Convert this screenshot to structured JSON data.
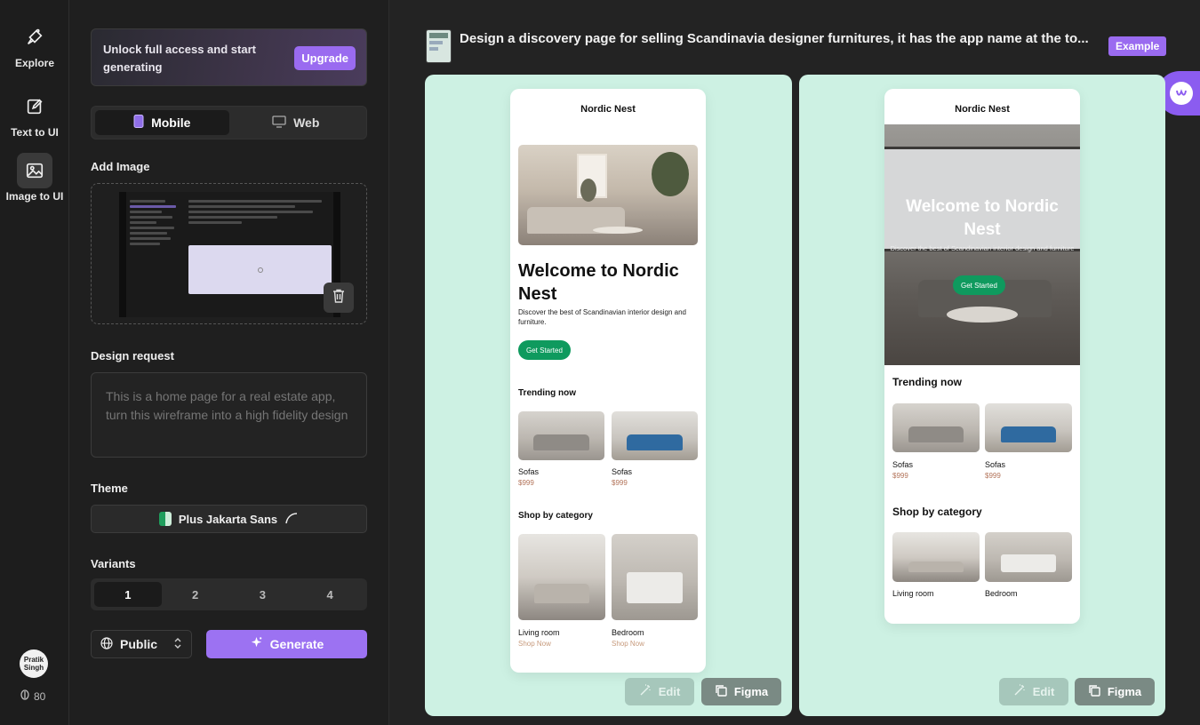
{
  "nav": {
    "items": [
      {
        "label": "Explore",
        "icon": "explore-icon"
      },
      {
        "label": "Text to UI",
        "icon": "pencil-square-icon"
      },
      {
        "label": "Image to UI",
        "icon": "image-icon"
      }
    ],
    "avatar_text": "Pratik Singh",
    "credits": "80"
  },
  "panel": {
    "promo_text": "Unlock full access and start generating",
    "upgrade_label": "Upgrade",
    "platform_tabs": [
      {
        "label": "Mobile",
        "icon": "mobile-icon",
        "active": true
      },
      {
        "label": "Web",
        "icon": "monitor-icon",
        "active": false
      }
    ],
    "add_image_label": "Add Image",
    "design_request_label": "Design request",
    "design_request_placeholder": "This is a home page for a real estate app, turn this wireframe into a high fidelity design",
    "theme_label": "Theme",
    "theme_value": "Plus Jakarta Sans",
    "variants_label": "Variants",
    "variants": [
      "1",
      "2",
      "3",
      "4"
    ],
    "visibility_label": "Public",
    "generate_label": "Generate"
  },
  "main": {
    "prompt": "Design a discovery page for selling Scandinavia designer furnitures, it has the app name at the to...",
    "badge": "Example",
    "edit_label": "Edit",
    "figma_label": "Figma",
    "accent_color": "#9a6bf0",
    "card_color": "#cdf1e3",
    "variant1": {
      "app_name": "Nordic Nest",
      "headline": "Welcome to Nordic Nest",
      "subtitle": "Discover the best of Scandinavian interior design and furniture.",
      "cta": "Get Started",
      "trending_title": "Trending now",
      "trending": [
        {
          "name": "Sofas",
          "price": "$999"
        },
        {
          "name": "Sofas",
          "price": "$999"
        }
      ],
      "category_title": "Shop by category",
      "categories": [
        {
          "name": "Living room",
          "link": "Shop Now"
        },
        {
          "name": "Bedroom",
          "link": "Shop Now"
        }
      ]
    },
    "variant2": {
      "app_name": "Nordic Nest",
      "headline": "Welcome to Nordic Nest",
      "subtitle": "Discover the best of Scandinavian interior design and furniture",
      "cta": "Get Started",
      "trending_title": "Trending now",
      "trending": [
        {
          "name": "Sofas",
          "price": "$999"
        },
        {
          "name": "Sofas",
          "price": "$999"
        }
      ],
      "category_title": "Shop by category",
      "categories": [
        {
          "name": "Living room"
        },
        {
          "name": "Bedroom"
        }
      ]
    }
  }
}
